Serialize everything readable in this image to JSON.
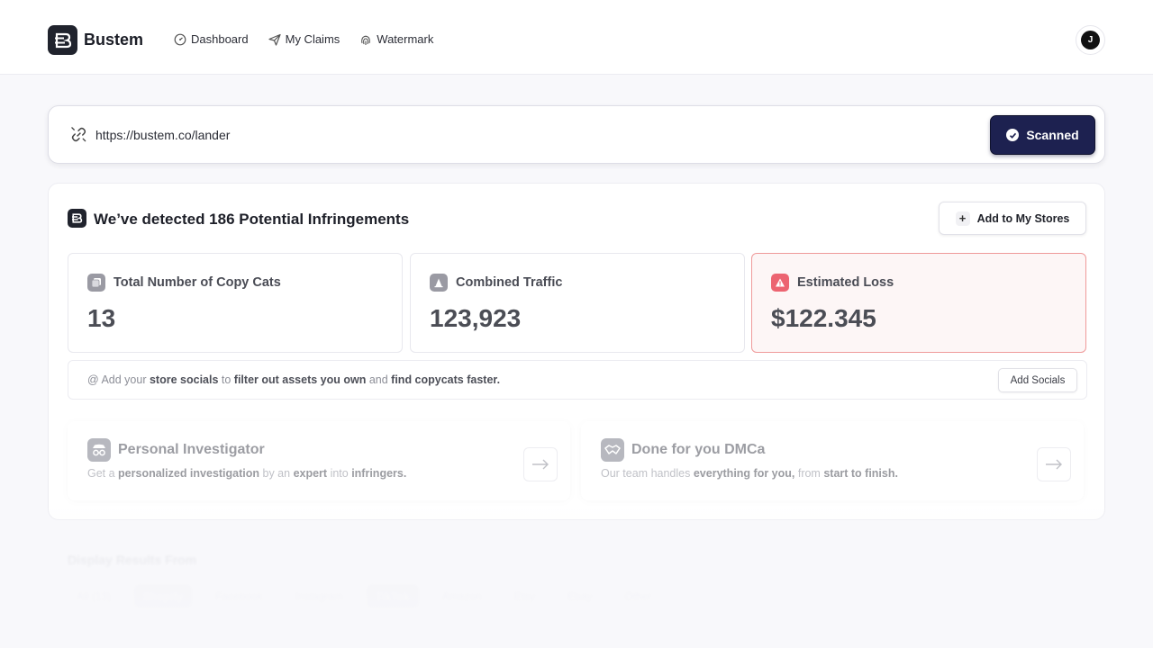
{
  "header": {
    "brand": "Bustem",
    "nav": [
      {
        "label": "Dashboard",
        "icon": "dashboard-icon"
      },
      {
        "label": "My Claims",
        "icon": "paper-plane-icon"
      },
      {
        "label": "Watermark",
        "icon": "fingerprint-icon"
      }
    ],
    "avatar_initial": "J"
  },
  "urlbar": {
    "url": "https://bustem.co/lander",
    "button_label": "Scanned"
  },
  "card": {
    "title": "We’ve detected 186 Potential Infringements",
    "add_stores_label": "Add to My Stores",
    "stats": [
      {
        "label": "Total Number of Copy Cats",
        "value": "13"
      },
      {
        "label": "Combined Traffic",
        "value": "123,923"
      },
      {
        "label": "Estimated Loss",
        "value": "$122.345"
      }
    ],
    "socials": {
      "t1": "@ Add your ",
      "b1": "store socials",
      "t2": " to ",
      "b2": "filter out assets you own",
      "t3": " and ",
      "b3": "find copycats faster.",
      "button_label": "Add Socials"
    },
    "promos": [
      {
        "title": "Personal Investigator",
        "d1": "Get a ",
        "b1": "personalized investigation",
        "d2": " by an ",
        "b2": "expert",
        "d3": " into ",
        "b3": "infringers."
      },
      {
        "title": "Done for you DMCa",
        "d1": "Our team handles ",
        "b1": "everything for you,",
        "d2": " from ",
        "b2": "start to finish.",
        "d3": "",
        "b3": ""
      }
    ]
  },
  "results": {
    "label": "Display Results From",
    "filters": [
      "All (13)",
      "Shopify",
      "Facebook",
      "Instagram",
      "TikTok",
      "Amazon",
      "Etsy",
      "Ebay",
      "Other"
    ]
  },
  "colors": {
    "accent": "#1d2150",
    "loss_red": "#ec6471"
  }
}
